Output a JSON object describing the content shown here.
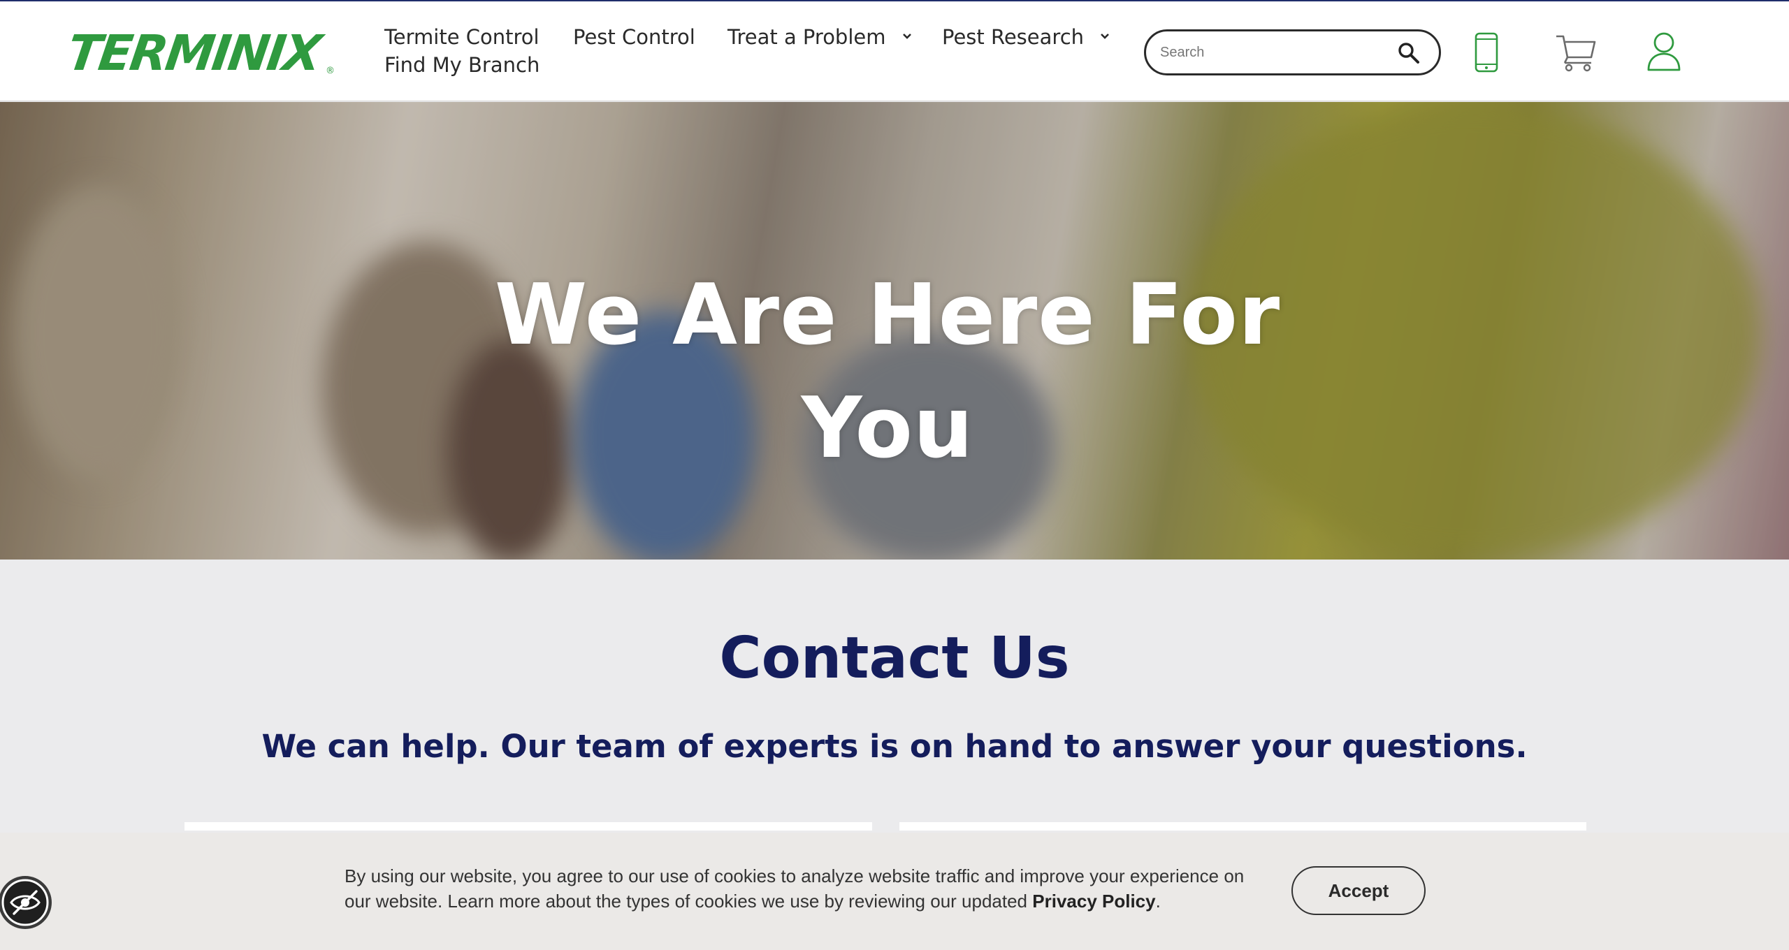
{
  "header": {
    "logo_text": "TERMINIX",
    "logo_reg": "®",
    "nav": {
      "termite_control": "Termite Control",
      "find_branch": "Find My Branch",
      "pest_control": "Pest Control",
      "treat_problem": "Treat a Problem",
      "pest_research": "Pest Research"
    },
    "search_placeholder": "Search",
    "icons": [
      "search-icon",
      "phone-icon",
      "cart-icon",
      "user-icon"
    ]
  },
  "hero": {
    "title": "We Are Here For You"
  },
  "contact": {
    "title": "Contact Us",
    "subtitle": "We can help. Our team of experts is on hand to answer your questions."
  },
  "cookie_banner": {
    "text": "By using our website, you agree to our use of cookies to analyze website traffic and improve your experience on our website. Learn more about the types of cookies we use by reviewing our updated",
    "policy_link": "Privacy Policy",
    "period": ".",
    "accept_label": "Accept"
  },
  "colors": {
    "brand_green": "#2f9a3f",
    "navy": "#141d5c",
    "page_bg": "#ebebed"
  }
}
